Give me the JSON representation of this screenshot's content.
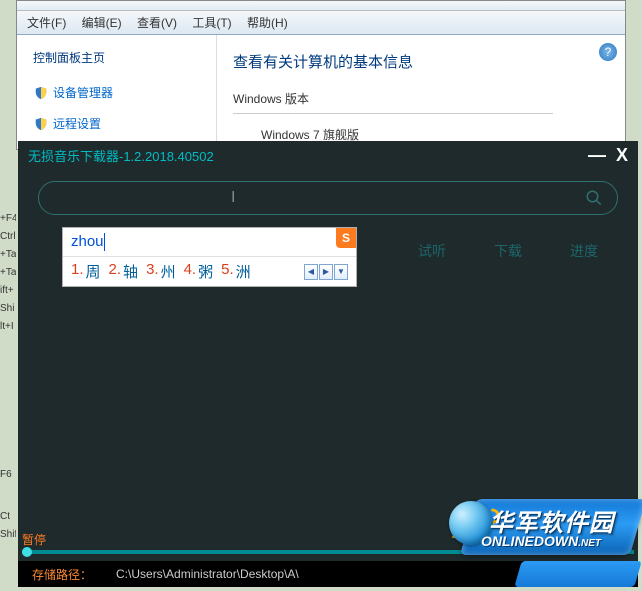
{
  "bg": {
    "menu": {
      "file": "文件(F)",
      "edit": "编辑(E)",
      "view": "查看(V)",
      "tools": "工具(T)",
      "help": "帮助(H)"
    },
    "sidebar": {
      "title": "控制面板主页",
      "items": [
        {
          "label": "设备管理器"
        },
        {
          "label": "远程设置"
        }
      ]
    },
    "main": {
      "title": "查看有关计算机的基本信息",
      "section_label": "Windows 版本",
      "section_value": "Windows 7 旗舰版"
    }
  },
  "hints": [
    "+F4",
    "Ctrl",
    "+Ta",
    "+Ta",
    "ift+",
    "Shi",
    "lt+I",
    "",
    "",
    "",
    "F6",
    "",
    "Ct",
    "Shif"
  ],
  "app": {
    "title": "无损音乐下载器-1.2.2018.40502",
    "search_value": "",
    "actions": {
      "preview": "试听",
      "download": "下载",
      "progress": "进度"
    },
    "ime": {
      "input": "zhou",
      "candidates": [
        {
          "num": "1.",
          "char": "周"
        },
        {
          "num": "2.",
          "char": "轴"
        },
        {
          "num": "3.",
          "char": "州"
        },
        {
          "num": "4.",
          "char": "粥"
        },
        {
          "num": "5.",
          "char": "洲"
        }
      ]
    },
    "player": {
      "pause_label": "暂停"
    },
    "save": {
      "label": "存储路径：",
      "path": "C:\\Users\\Administrator\\Desktop\\A\\"
    }
  },
  "watermark": {
    "cn": "华军软件园",
    "en": "ONLINEDOWN",
    "net": ".NET"
  }
}
